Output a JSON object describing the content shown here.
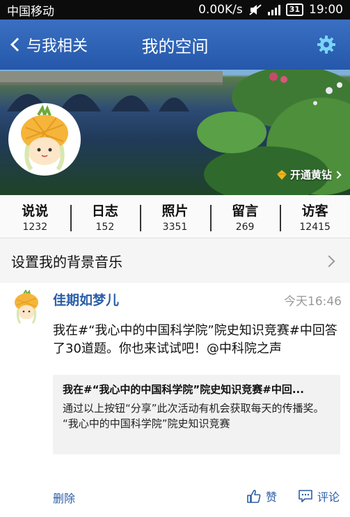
{
  "status_bar": {
    "carrier": "中国移动",
    "speed": "0.00K/s",
    "battery": "31",
    "time": "19:00"
  },
  "nav": {
    "back_label": "与我相关",
    "title": "我的空间",
    "settings_icon": "gear-icon"
  },
  "cover": {
    "vip_label": "开通黄钻"
  },
  "stats": [
    {
      "label": "说说",
      "count": "1232"
    },
    {
      "label": "日志",
      "count": "152"
    },
    {
      "label": "照片",
      "count": "3351"
    },
    {
      "label": "留言",
      "count": "269"
    },
    {
      "label": "访客",
      "count": "12415"
    }
  ],
  "music_row": {
    "label": "设置我的背景音乐"
  },
  "feed": {
    "user": "佳期如梦儿",
    "time": "今天16:46",
    "body": "我在#“我心中的中国科学院”院史知识竞赛#中回答了30道题。你也来试试吧！@中科院之声",
    "card_title": "我在#“我心中的中国科学院”院史知识竞赛#中回...",
    "card_desc": "通过以上按钮“分享”此次活动有机会获取每天的传播奖。",
    "card_sub": "“我心中的中国科学院”院史知识竞赛",
    "delete_label": "删除",
    "like_label": "赞",
    "comment_label": "评论"
  },
  "colors": {
    "nav_bg": "#2d63b6",
    "link": "#2a5da8"
  }
}
